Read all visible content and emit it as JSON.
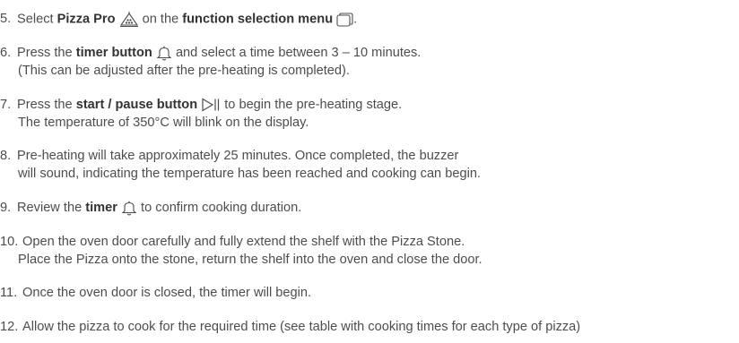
{
  "steps": [
    {
      "num": "5.",
      "a": "Select ",
      "b1": "Pizza Pro",
      "c": " on the ",
      "b2": "function selection menu",
      "d": "."
    },
    {
      "num": "6.",
      "a": "Press the ",
      "b1": "timer button",
      "c": " and select a time between 3 – 10 minutes.",
      "line2": "(This can be adjusted after the pre-heating is completed)."
    },
    {
      "num": "7.",
      "a": "Press the ",
      "b1": "start / pause button",
      "c": " to begin the pre-heating stage.",
      "line2": "The temperature of 350°C will blink on the display."
    },
    {
      "num": "8.",
      "a": "Pre-heating will take approximately 25 minutes. Once completed, the buzzer",
      "line2": "will sound, indicating the temperature has been reached and cooking can begin."
    },
    {
      "num": "9.",
      "a": "Review the ",
      "b1": "timer",
      "c": " to confirm cooking duration."
    },
    {
      "num": "10.",
      "a": "Open the oven door carefully and fully extend the shelf with the Pizza Stone.",
      "line2": "Place the Pizza onto the stone, return the shelf into the oven and close the door."
    },
    {
      "num": "11.",
      "a": "Once the oven door is closed, the timer will begin."
    },
    {
      "num": "12.",
      "a": "Allow the pizza to cook for the required time (see table with cooking times for each type of pizza)"
    }
  ],
  "icons": {
    "pizza_pro": "pizza-pro-icon",
    "function_menu": "function-menu-icon",
    "timer": "bell-icon",
    "start_pause": "play-pause-icon"
  },
  "colors": {
    "text": "#4d4d4d",
    "bold": "#333333"
  }
}
